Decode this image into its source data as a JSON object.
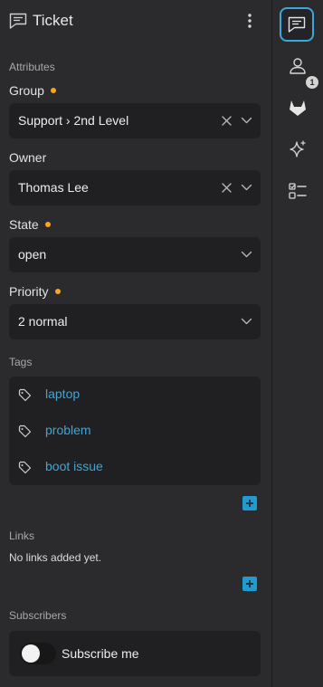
{
  "header": {
    "title": "Ticket",
    "icon": "ticket-chat-icon",
    "menu_icon": "kebab-menu-icon"
  },
  "attributes": {
    "section_label": "Attributes",
    "group": {
      "label": "Group",
      "value": "Support › 2nd Level",
      "required": true
    },
    "owner": {
      "label": "Owner",
      "value": "Thomas Lee",
      "required": false
    },
    "state": {
      "label": "State",
      "value": "open",
      "required": true
    },
    "priority": {
      "label": "Priority",
      "value": "2 normal",
      "required": true
    }
  },
  "tags": {
    "section_label": "Tags",
    "items": [
      "laptop",
      "problem",
      "boot issue"
    ]
  },
  "links": {
    "section_label": "Links",
    "empty_text": "No links added yet."
  },
  "subscribers": {
    "section_label": "Subscribers",
    "subscribe_label": "Subscribe me",
    "subscribed": false
  },
  "sidebar_rail": {
    "items": [
      {
        "name": "ticket-chat-icon",
        "active": true
      },
      {
        "name": "customer-person-icon",
        "active": false,
        "badge": "1"
      },
      {
        "name": "gitlab-icon",
        "active": false
      },
      {
        "name": "ai-sparkle-icon",
        "active": false
      },
      {
        "name": "checklist-icon",
        "active": false
      }
    ]
  },
  "colors": {
    "accent": "#3fa6d9",
    "required_dot": "#f6a623",
    "background": "#2b2b2d",
    "field_background": "#202022"
  }
}
